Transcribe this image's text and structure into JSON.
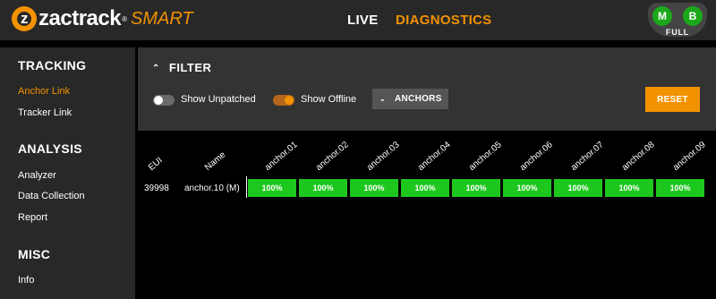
{
  "header": {
    "logo_mark": "z",
    "brand": "zactrack",
    "brand_reg": "®",
    "brand_sub": "SMART",
    "nav": {
      "live": "LIVE",
      "diagnostics": "DIAGNOSTICS"
    },
    "status": {
      "left": "M",
      "right": "B",
      "label": "FULL"
    }
  },
  "sidebar": {
    "tracking": {
      "heading": "TRACKING",
      "items": [
        "Anchor Link",
        "Tracker Link"
      ],
      "active": "Anchor Link"
    },
    "analysis": {
      "heading": "ANALYSIS",
      "items": [
        "Analyzer",
        "Data Collection",
        "Report"
      ]
    },
    "misc": {
      "heading": "MISC",
      "items": [
        "Info"
      ]
    }
  },
  "filter": {
    "title": "FILTER",
    "show_unpatched": {
      "label": "Show Unpatched",
      "on": false
    },
    "show_offline": {
      "label": "Show Offline",
      "on": true
    },
    "anchors_label": "ANCHORS",
    "reset_label": "RESET"
  },
  "table": {
    "headers": [
      "EUI",
      "Name",
      "anchor.01",
      "anchor.02",
      "anchor.03",
      "anchor.04",
      "anchor.05",
      "anchor.06",
      "anchor.07",
      "anchor.08",
      "anchor.09"
    ],
    "rows": [
      {
        "eui": "39998",
        "name": "anchor.10 (M)",
        "values": [
          "100%",
          "100%",
          "100%",
          "100%",
          "100%",
          "100%",
          "100%",
          "100%",
          "100%"
        ]
      }
    ]
  },
  "colors": {
    "accent": "#f39200",
    "ok": "#1ec71e",
    "status_green": "#1ba81b"
  }
}
